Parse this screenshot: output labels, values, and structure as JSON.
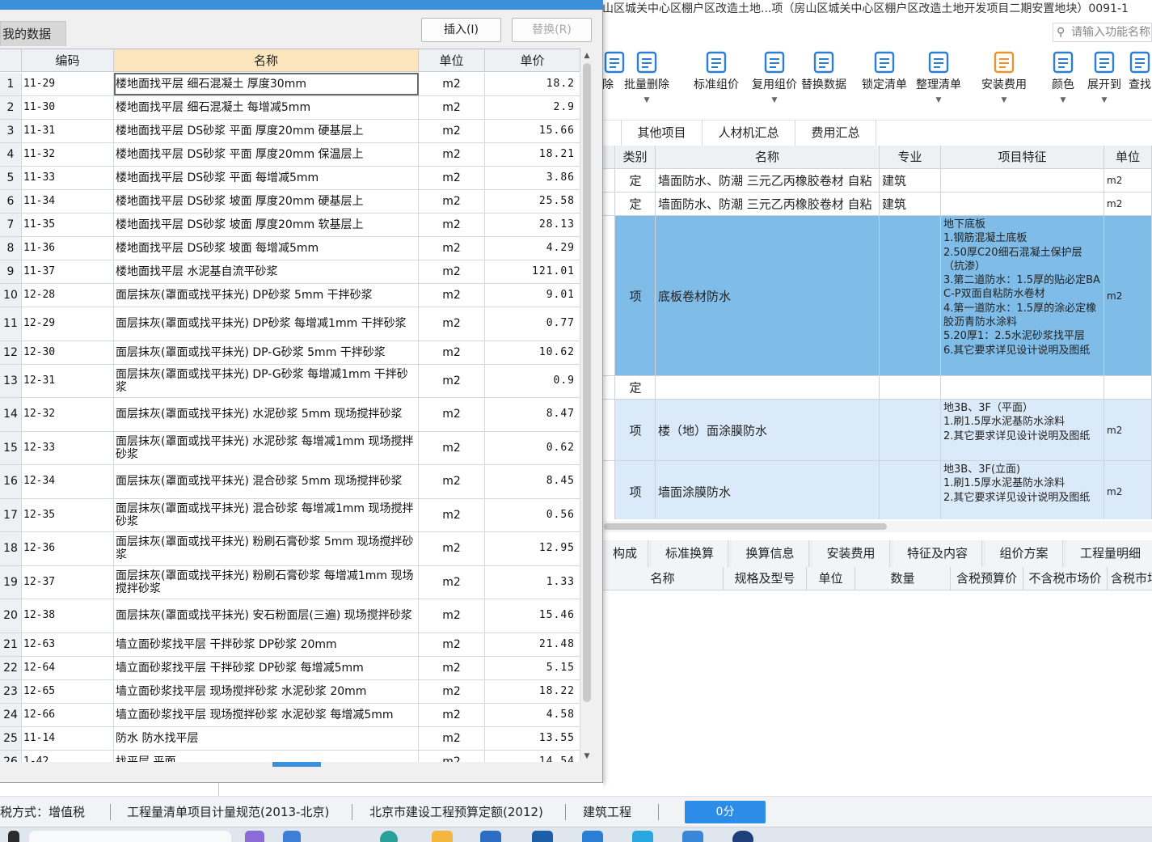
{
  "main_window": {
    "title": "山区城关中心区棚户区改造土地...项（房山区城关中心区棚户区改造土地开发项目二期安置地块）0091-1",
    "search_placeholder": "请输入功能名称",
    "toolbar": [
      {
        "label": "除",
        "icon": "delete-icon",
        "has_arrow": false
      },
      {
        "label": "批量删除",
        "icon": "batch-delete-icon",
        "has_arrow": true
      },
      {
        "label": "标准组价",
        "icon": "standard-pricing-icon",
        "has_arrow": false
      },
      {
        "label": "复用组价",
        "icon": "reuse-pricing-icon",
        "has_arrow": true
      },
      {
        "label": "替换数据",
        "icon": "replace-data-icon",
        "has_arrow": false
      },
      {
        "label": "锁定清单",
        "icon": "lock-list-icon",
        "has_arrow": false
      },
      {
        "label": "整理清单",
        "icon": "organize-list-icon",
        "has_arrow": true
      },
      {
        "label": "安装费用",
        "icon": "install-cost-icon",
        "has_arrow": true
      },
      {
        "label": "颜色",
        "icon": "color-icon",
        "has_arrow": true
      },
      {
        "label": "展开到",
        "icon": "expand-to-icon",
        "has_arrow": true
      },
      {
        "label": "查找",
        "icon": "find-icon",
        "has_arrow": false
      }
    ],
    "top_tabs": [
      "其他项目",
      "人材机汇总",
      "费用汇总"
    ],
    "list_columns": [
      "类别",
      "名称",
      "专业",
      "项目特征",
      "单位"
    ],
    "list_rows": [
      {
        "category": "定",
        "name": "墙面防水、防潮 三元乙丙橡胶卷材 自粘",
        "major": "建筑",
        "feature": "",
        "unit": "m2",
        "style": "normal"
      },
      {
        "category": "定",
        "name": "墙面防水、防潮 三元乙丙橡胶卷材 自粘",
        "major": "建筑",
        "feature": "",
        "unit": "m2",
        "style": "normal"
      },
      {
        "category": "项",
        "name": "底板卷材防水",
        "major": "",
        "feature": "地下底板\n1.钢筋混凝土底板\n2.50厚C20细石混凝土保护层（抗渗）\n3.第二道防水：1.5厚的贴必定BAC-P双面自粘防水卷材\n4.第一道防水：1.5厚的涂必定橡胶沥青防水涂料\n5.20厚1：2.5水泥砂浆找平层\n6.其它要求详见设计说明及图纸",
        "unit": "m2",
        "style": "selected"
      },
      {
        "category": "定",
        "name": "",
        "major": "",
        "feature": "",
        "unit": "",
        "style": "normal"
      },
      {
        "category": "项",
        "name": "楼（地）面涂膜防水",
        "major": "",
        "feature": "地3B、3F（平面）\n1.刷1.5厚水泥基防水涂料\n2.其它要求详见设计说明及图纸",
        "unit": "m2",
        "style": "light"
      },
      {
        "category": "项",
        "name": "墙面涂膜防水",
        "major": "",
        "feature": "地3B、3F(立面)\n1.刷1.5厚水泥基防水涂料\n2.其它要求详见设计说明及图纸",
        "unit": "m2",
        "style": "light"
      }
    ],
    "bottom_tabs": [
      "构成",
      "标准换算",
      "换算信息",
      "安装费用",
      "特征及内容",
      "组价方案",
      "工程量明细"
    ],
    "detail_columns": [
      "名称",
      "规格及型号",
      "单位",
      "数量",
      "含税预算价",
      "不含税市场价",
      "含税市场"
    ],
    "status": {
      "tax_mode": "税方式：增值税",
      "spec": "工程量清单项目计量规范(2013-北京)",
      "quota": "北京市建设工程预算定额(2012)",
      "major": "建筑工程",
      "score": "0分"
    }
  },
  "dialog": {
    "tab_label": "我的数据",
    "insert_button": "插入(I)",
    "replace_button": "替换(R)",
    "columns": [
      "编码",
      "名称",
      "单位",
      "单价"
    ],
    "rows": [
      {
        "no": "1",
        "code": "11-29",
        "name": "楼地面找平层 细石混凝土 厚度30mm",
        "unit": "m2",
        "price": "18.2"
      },
      {
        "no": "2",
        "code": "11-30",
        "name": "楼地面找平层 细石混凝土 每增减5mm",
        "unit": "m2",
        "price": "2.9"
      },
      {
        "no": "3",
        "code": "11-31",
        "name": "楼地面找平层 DS砂浆 平面 厚度20mm 硬基层上",
        "unit": "m2",
        "price": "15.66"
      },
      {
        "no": "4",
        "code": "11-32",
        "name": "楼地面找平层 DS砂浆 平面 厚度20mm 保温层上",
        "unit": "m2",
        "price": "18.21"
      },
      {
        "no": "5",
        "code": "11-33",
        "name": "楼地面找平层 DS砂浆 平面 每增减5mm",
        "unit": "m2",
        "price": "3.86"
      },
      {
        "no": "6",
        "code": "11-34",
        "name": "楼地面找平层 DS砂浆 坡面 厚度20mm 硬基层上",
        "unit": "m2",
        "price": "25.58"
      },
      {
        "no": "7",
        "code": "11-35",
        "name": "楼地面找平层 DS砂浆 坡面 厚度20mm 软基层上",
        "unit": "m2",
        "price": "28.13"
      },
      {
        "no": "8",
        "code": "11-36",
        "name": "楼地面找平层 DS砂浆 坡面 每增减5mm",
        "unit": "m2",
        "price": "4.29"
      },
      {
        "no": "9",
        "code": "11-37",
        "name": "楼地面找平层 水泥基自流平砂浆",
        "unit": "m2",
        "price": "121.01"
      },
      {
        "no": "10",
        "code": "12-28",
        "name": "面层抹灰(罩面或找平抹光) DP砂浆 5mm 干拌砂浆",
        "unit": "m2",
        "price": "9.01"
      },
      {
        "no": "11",
        "code": "12-29",
        "name": "面层抹灰(罩面或找平抹光) DP砂浆 每增减1mm 干拌砂浆",
        "unit": "m2",
        "price": "0.77"
      },
      {
        "no": "12",
        "code": "12-30",
        "name": "面层抹灰(罩面或找平抹光) DP-G砂浆 5mm 干拌砂浆",
        "unit": "m2",
        "price": "10.62"
      },
      {
        "no": "13",
        "code": "12-31",
        "name": "面层抹灰(罩面或找平抹光) DP-G砂浆 每增减1mm 干拌砂浆",
        "unit": "m2",
        "price": "0.9"
      },
      {
        "no": "14",
        "code": "12-32",
        "name": "面层抹灰(罩面或找平抹光) 水泥砂浆 5mm 现场搅拌砂浆",
        "unit": "m2",
        "price": "8.47"
      },
      {
        "no": "15",
        "code": "12-33",
        "name": "面层抹灰(罩面或找平抹光) 水泥砂浆 每增减1mm 现场搅拌砂浆",
        "unit": "m2",
        "price": "0.62"
      },
      {
        "no": "16",
        "code": "12-34",
        "name": "面层抹灰(罩面或找平抹光) 混合砂浆 5mm 现场搅拌砂浆",
        "unit": "m2",
        "price": "8.45"
      },
      {
        "no": "17",
        "code": "12-35",
        "name": "面层抹灰(罩面或找平抹光) 混合砂浆 每增减1mm 现场搅拌砂浆",
        "unit": "m2",
        "price": "0.56"
      },
      {
        "no": "18",
        "code": "12-36",
        "name": "面层抹灰(罩面或找平抹光) 粉刷石膏砂浆 5mm 现场搅拌砂浆",
        "unit": "m2",
        "price": "12.95"
      },
      {
        "no": "19",
        "code": "12-37",
        "name": "面层抹灰(罩面或找平抹光) 粉刷石膏砂浆 每增减1mm 现场搅拌砂浆",
        "unit": "m2",
        "price": "1.33"
      },
      {
        "no": "20",
        "code": "12-38",
        "name": "面层抹灰(罩面或找平抹光) 安石粉面层(三遍) 现场搅拌砂浆",
        "unit": "m2",
        "price": "15.46"
      },
      {
        "no": "21",
        "code": "12-63",
        "name": "墙立面砂浆找平层 干拌砂浆 DP砂浆 20mm",
        "unit": "m2",
        "price": "21.48"
      },
      {
        "no": "22",
        "code": "12-64",
        "name": "墙立面砂浆找平层 干拌砂浆 DP砂浆 每增减5mm",
        "unit": "m2",
        "price": "5.15"
      },
      {
        "no": "23",
        "code": "12-65",
        "name": "墙立面砂浆找平层 现场搅拌砂浆 水泥砂浆 20mm",
        "unit": "m2",
        "price": "18.22"
      },
      {
        "no": "24",
        "code": "12-66",
        "name": "墙立面砂浆找平层 现场搅拌砂浆 水泥砂浆 每增减5mm",
        "unit": "m2",
        "price": "4.58"
      },
      {
        "no": "25",
        "code": "11-14",
        "name": "防水 防水找平层",
        "unit": "m2",
        "price": "13.55"
      },
      {
        "no": "26",
        "code": "1-42",
        "name": "找平层 平面",
        "unit": "m2",
        "price": "14.54"
      }
    ]
  },
  "colors": {
    "accent": "#3c8fdb",
    "selected_row": "#7fbce8",
    "light_row": "#dbeaf8",
    "header_highlight": "#fde6bd",
    "status_button": "#2d8ce8"
  }
}
